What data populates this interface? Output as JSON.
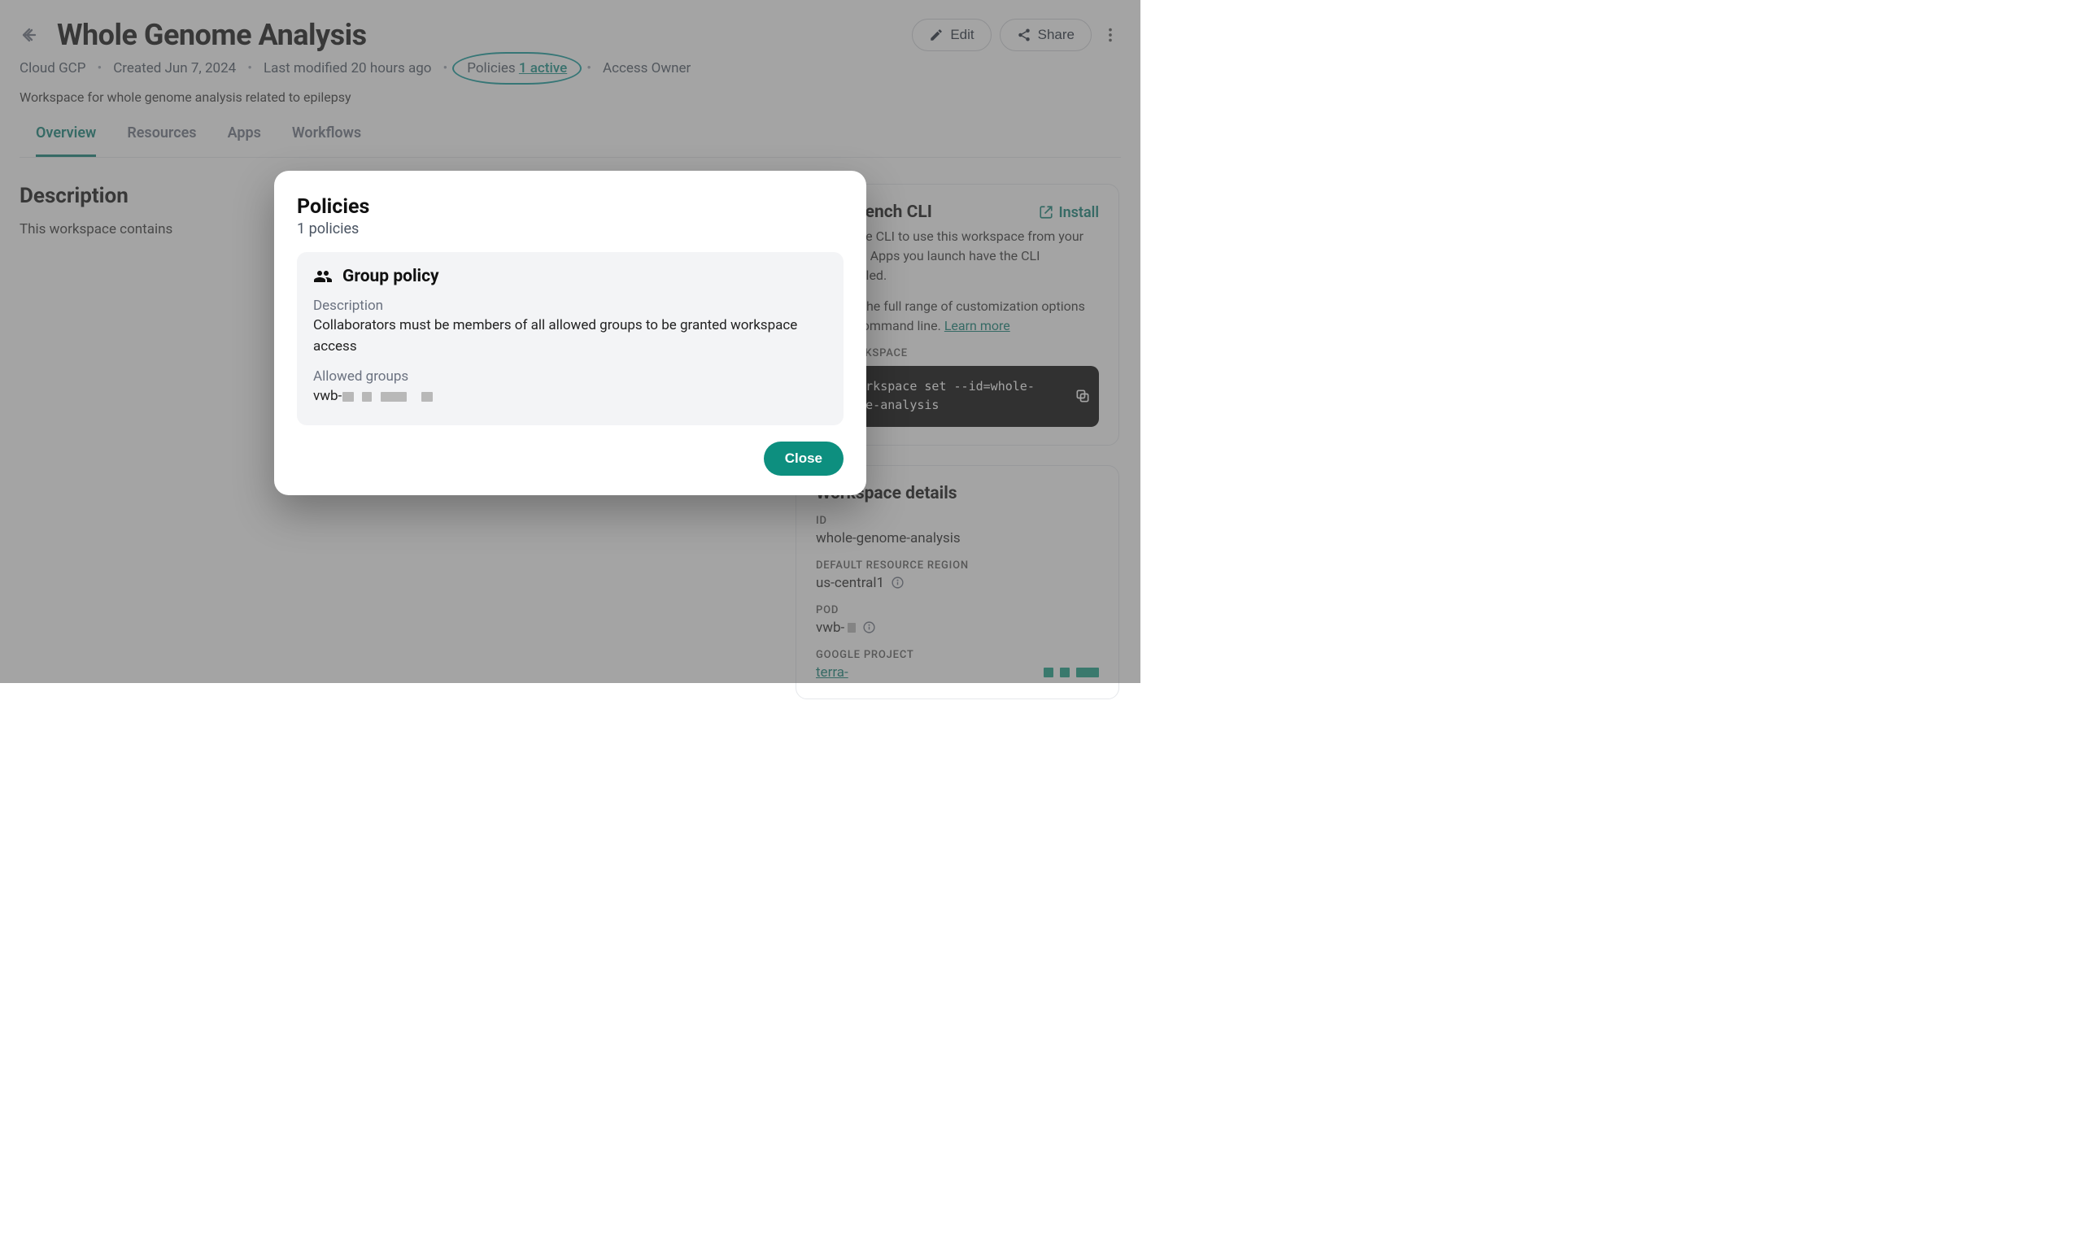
{
  "header": {
    "title": "Whole Genome Analysis",
    "edit_label": "Edit",
    "share_label": "Share"
  },
  "meta": {
    "cloud": "Cloud GCP",
    "created_prefix": "Created",
    "created_date": "Jun 7, 2024",
    "modified_prefix": "Last modified",
    "modified_value": "20 hours ago",
    "policies_word": "Policies",
    "policies_link": "1 active",
    "access_prefix": "Access",
    "access_value": "Owner",
    "description_line": "Workspace for whole genome analysis related to epilepsy"
  },
  "tabs": {
    "overview": "Overview",
    "resources": "Resources",
    "apps": "Apps",
    "workflows": "Workflows"
  },
  "main": {
    "section_title": "Description",
    "body_text": "This workspace contains"
  },
  "cli": {
    "title": "Workbench CLI",
    "install": "Install",
    "para1": "Install the CLI to use this workspace from your terminal. Apps you launch have the CLI preinstalled.",
    "para2_prefix": "Explore the full range of customization options on the command line. ",
    "learn_more": "Learn more",
    "set_label": "SET WORKSPACE",
    "command": "wb workspace set --id=whole-genome-analysis"
  },
  "details": {
    "title": "Workspace details",
    "id_label": "ID",
    "id_value": "whole-genome-analysis",
    "region_label": "DEFAULT RESOURCE REGION",
    "region_value": "us-central1",
    "pod_label": "POD",
    "pod_value_prefix": "vwb-",
    "gproj_label": "GOOGLE PROJECT",
    "gproj_value_prefix": "terra-"
  },
  "modal": {
    "title": "Policies",
    "subtitle": "1 policies",
    "policy_name": "Group policy",
    "desc_label": "Description",
    "desc_value": "Collaborators must be members of all allowed groups to be granted workspace access",
    "groups_label": "Allowed groups",
    "groups_value_prefix": "vwb-",
    "close": "Close"
  }
}
